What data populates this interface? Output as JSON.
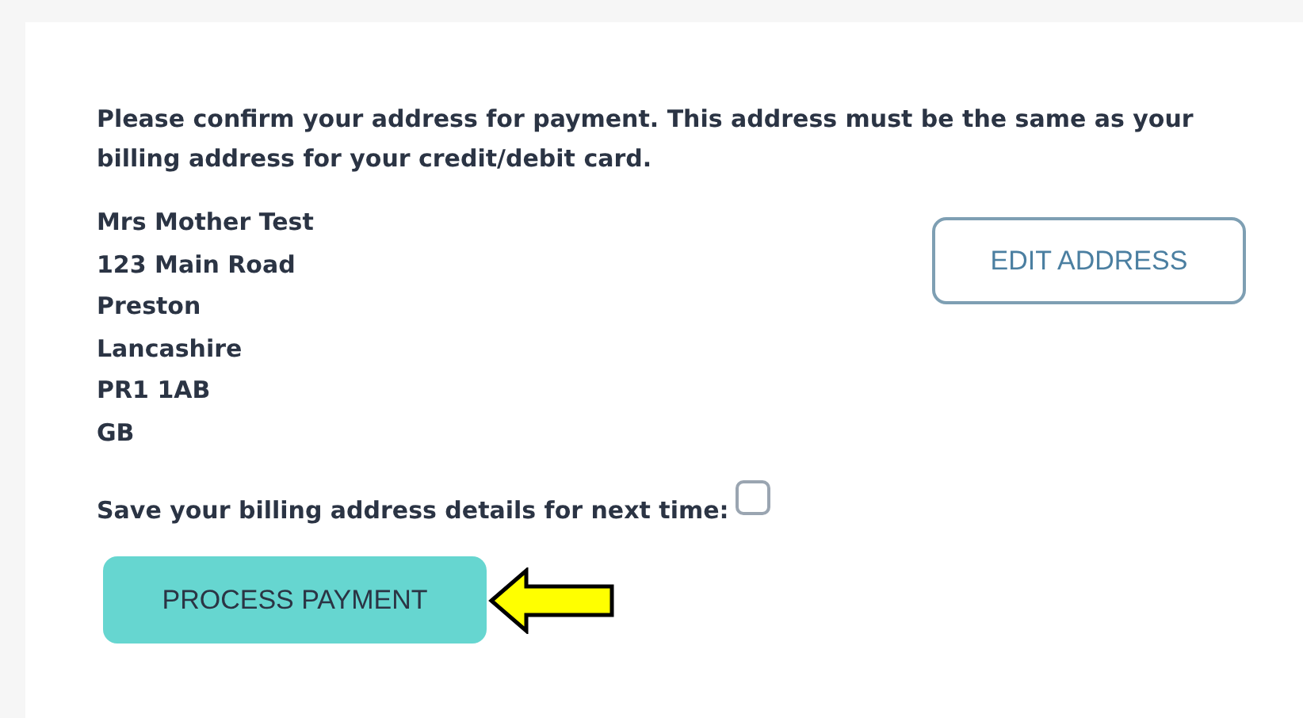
{
  "intro": "Please confirm your address for payment. This address must be the same as your billing address for your credit/debit card.",
  "address_lines": [
    "Mrs Mother Test",
    "123 Main Road",
    "Preston",
    "Lancashire",
    "PR1 1AB",
    "GB"
  ],
  "edit_button": "EDIT ADDRESS",
  "save_details": {
    "label": "Save your billing address details for next time:",
    "checked": false
  },
  "submit_button": "PROCESS PAYMENT"
}
